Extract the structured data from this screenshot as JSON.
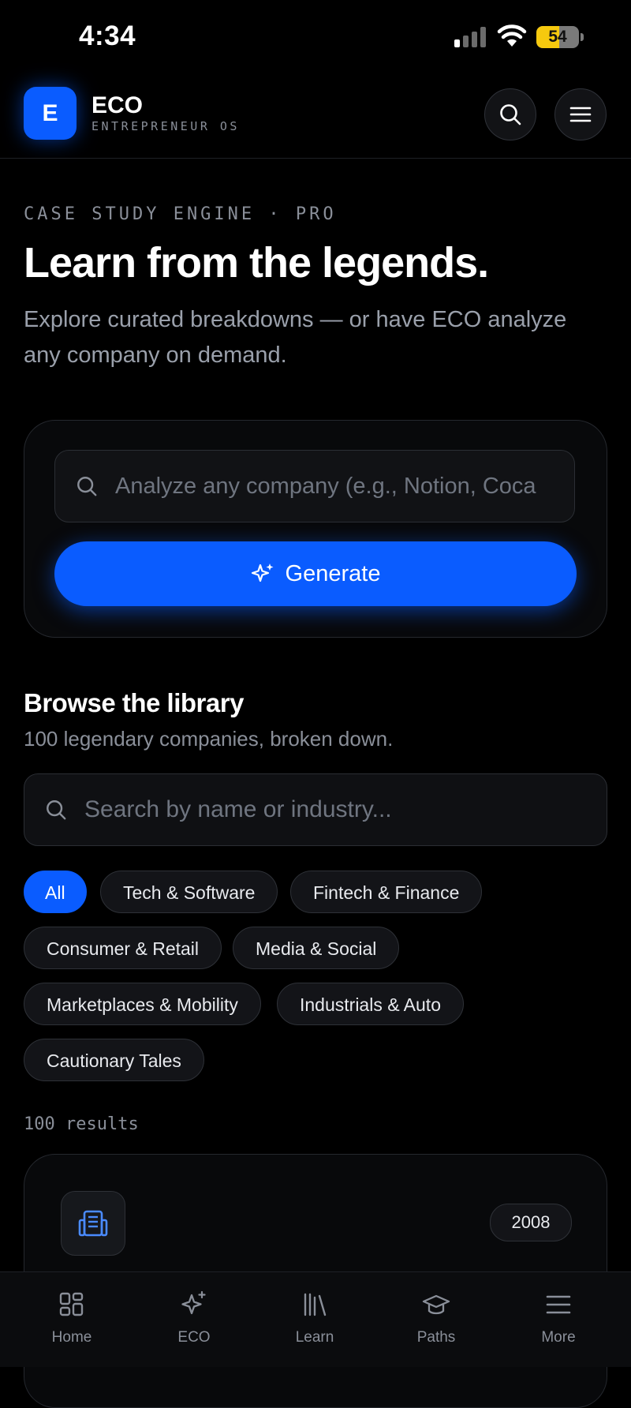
{
  "status_bar": {
    "time": "4:34",
    "battery": "54",
    "battery_level": 0.54
  },
  "header": {
    "logo_letter": "E",
    "brand": "ECO",
    "brand_sub": "ENTREPRENEUR OS"
  },
  "hero": {
    "eyebrow": "CASE STUDY ENGINE · PRO",
    "title": "Learn from the legends.",
    "subtitle": "Explore curated breakdowns — or have ECO analyze any company on demand."
  },
  "generator": {
    "placeholder": "Analyze any company (e.g., Notion, Coca",
    "button_label": "Generate"
  },
  "library": {
    "title": "Browse the library",
    "subtitle": "100 legendary companies, broken down.",
    "search_placeholder": "Search by name or industry...",
    "filters": [
      "All",
      "Tech & Software",
      "Fintech & Finance",
      "Consumer & Retail",
      "Media & Social",
      "Marketplaces & Mobility",
      "Industrials & Auto",
      "Cautionary Tales"
    ],
    "active_filter": "All",
    "results_count": "100 results"
  },
  "companies": [
    {
      "year": "2008",
      "icon": "building-icon"
    }
  ],
  "bottom_nav": [
    {
      "label": "Home",
      "icon": "grid-icon"
    },
    {
      "label": "ECO",
      "icon": "sparkle-icon"
    },
    {
      "label": "Learn",
      "icon": "library-icon"
    },
    {
      "label": "Paths",
      "icon": "graduation-cap-icon"
    },
    {
      "label": "More",
      "icon": "menu-icon"
    }
  ],
  "colors": {
    "accent": "#0a5cff",
    "background": "#000000",
    "battery": "#f6c90e"
  }
}
